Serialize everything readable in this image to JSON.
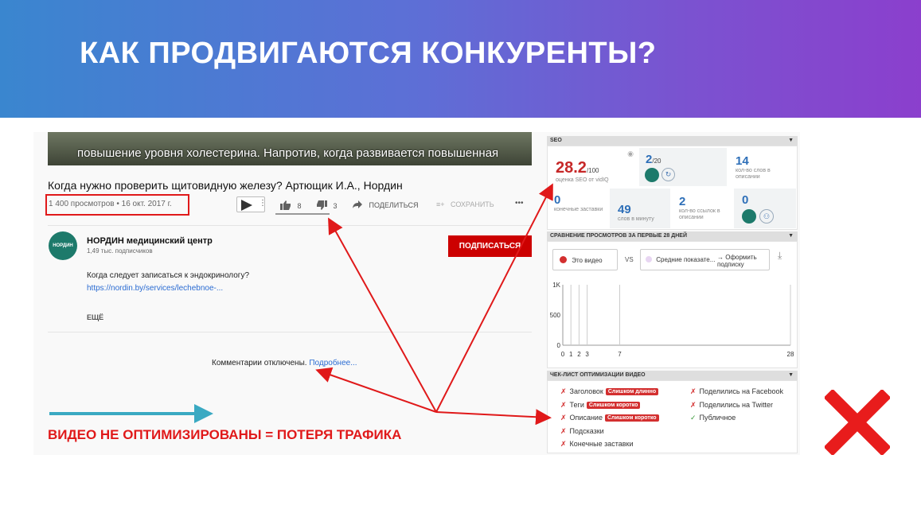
{
  "slide": {
    "title": "КАК ПРОДВИГАЮТСЯ КОНКУРЕНТЫ?"
  },
  "youtube": {
    "subtitle_text": "повышение уровня холестерина. Напротив, когда развивается повышенная",
    "video_title": "Когда нужно проверить щитовидную железу? Артющик И.А., Нордин",
    "views_date": "1 400 просмотров • 16 окт. 2017 г.",
    "likes": "8",
    "dislikes": "3",
    "share_label": "ПОДЕЛИТЬСЯ",
    "save_label": "СОХРАНИТЬ",
    "more_icon": "•••",
    "channel_logo_text": "НОРДИН",
    "channel_name": "НОРДИН медицинский центр",
    "channel_subs": "1,49 тыс. подписчиков",
    "subscribe_label": "ПОДПИСАТЬСЯ",
    "description_line1": "Когда следует записаться к эндокринологу?",
    "description_link": "https://nordin.by/services/lechebnoe-...",
    "more_label": "ЕЩЁ",
    "comments_disabled": "Комментарии отключены.",
    "comments_more_link": "Подробнее..."
  },
  "callout": {
    "text": "ВИДЕО НЕ ОПТИМИЗИРОВАНЫ = ПОТЕРЯ ТРАФИКА"
  },
  "vidiq": {
    "seo_header": "SEO",
    "seo_score": "28.2",
    "seo_score_max": "/100",
    "seo_score_label": "оценка SEO от vidIQ",
    "tags_value": "2",
    "tags_max": "/20",
    "desc_words_value": "14",
    "desc_words_label": "кол-во слов в описании",
    "end_screens_value": "0",
    "end_screens_label": "конечные заставки",
    "wpm_value": "49",
    "wpm_label": "слов в минуту",
    "links_value": "2",
    "links_label": "кол-во ссылок в описании",
    "cards_value": "0",
    "views_header": "СРАВНЕНИЕ ПРОСМОТРОВ ЗА ПЕРВЫЕ 28 ДНЕЙ",
    "this_video_label": "Это видео",
    "vs_label": "VS",
    "avg_label": "Средние показате...",
    "subscribe_cta": "→ Оформить подписку",
    "chart_y_ticks": [
      "1K",
      "500",
      "0"
    ],
    "chart_x_ticks": [
      "0",
      "1",
      "2",
      "3",
      "7",
      "28"
    ],
    "checklist_header": "ЧЕК-ЛИСТ ОПТИМИЗАЦИИ ВИДЕО",
    "checklist_left": [
      {
        "label": "Заголовок",
        "badge": "Слишком длинно",
        "status": "fail"
      },
      {
        "label": "Теги",
        "badge": "Слишком коротко",
        "status": "fail"
      },
      {
        "label": "Описание",
        "badge": "Слишком коротко",
        "status": "fail"
      },
      {
        "label": "Подсказки",
        "badge": "",
        "status": "fail"
      },
      {
        "label": "Конечные заставки",
        "badge": "",
        "status": "fail"
      }
    ],
    "checklist_right": [
      {
        "label": "Поделились на Facebook",
        "status": "fail"
      },
      {
        "label": "Поделились на Twitter",
        "status": "fail"
      },
      {
        "label": "Публичное",
        "status": "ok"
      }
    ]
  },
  "colors": {
    "accent_red": "#e0191a",
    "arrow_teal": "#3aa9c2",
    "banner_start": "#3a86cf",
    "banner_end": "#8b3fcd"
  }
}
